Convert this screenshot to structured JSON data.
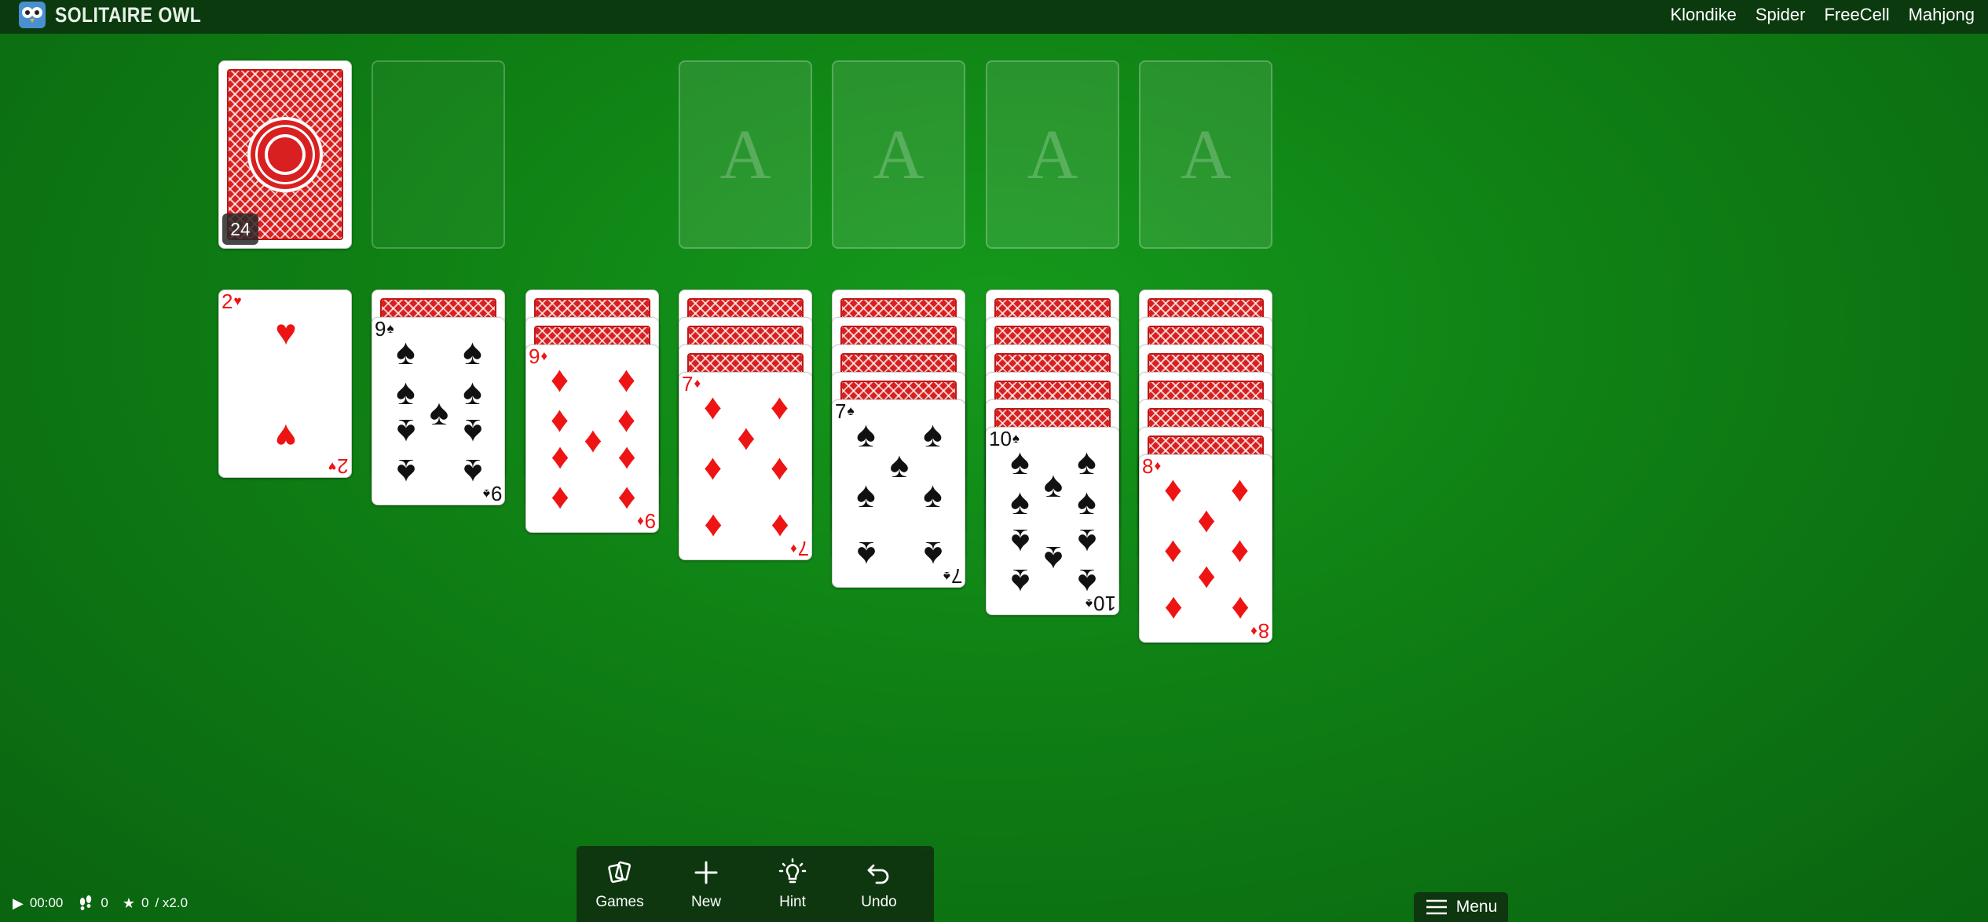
{
  "header": {
    "brand": "SOLITAIRE OWL",
    "nav": [
      "Klondike",
      "Spider",
      "FreeCell",
      "Mahjong"
    ]
  },
  "stock": {
    "count": "24"
  },
  "foundation_label": "A",
  "tableau": [
    {
      "face_down": 0,
      "rank": "2",
      "suit": "♥",
      "color": "red"
    },
    {
      "face_down": 1,
      "rank": "9",
      "suit": "♠",
      "color": "black"
    },
    {
      "face_down": 2,
      "rank": "9",
      "suit": "♦",
      "color": "red"
    },
    {
      "face_down": 3,
      "rank": "7",
      "suit": "♦",
      "color": "red"
    },
    {
      "face_down": 4,
      "rank": "7",
      "suit": "♠",
      "color": "black"
    },
    {
      "face_down": 5,
      "rank": "10",
      "suit": "♠",
      "color": "black"
    },
    {
      "face_down": 6,
      "rank": "8",
      "suit": "♦",
      "color": "red"
    }
  ],
  "stats": {
    "time": "00:00",
    "moves": "0",
    "score": "0",
    "multiplier": "/ x2.0"
  },
  "toolbar": {
    "games": "Games",
    "new": "New",
    "hint": "Hint",
    "undo": "Undo"
  },
  "menu_label": "Menu",
  "colors": {
    "felt": "#0f7f14",
    "card_red": "#ee1414",
    "card_back": "#d92020"
  }
}
